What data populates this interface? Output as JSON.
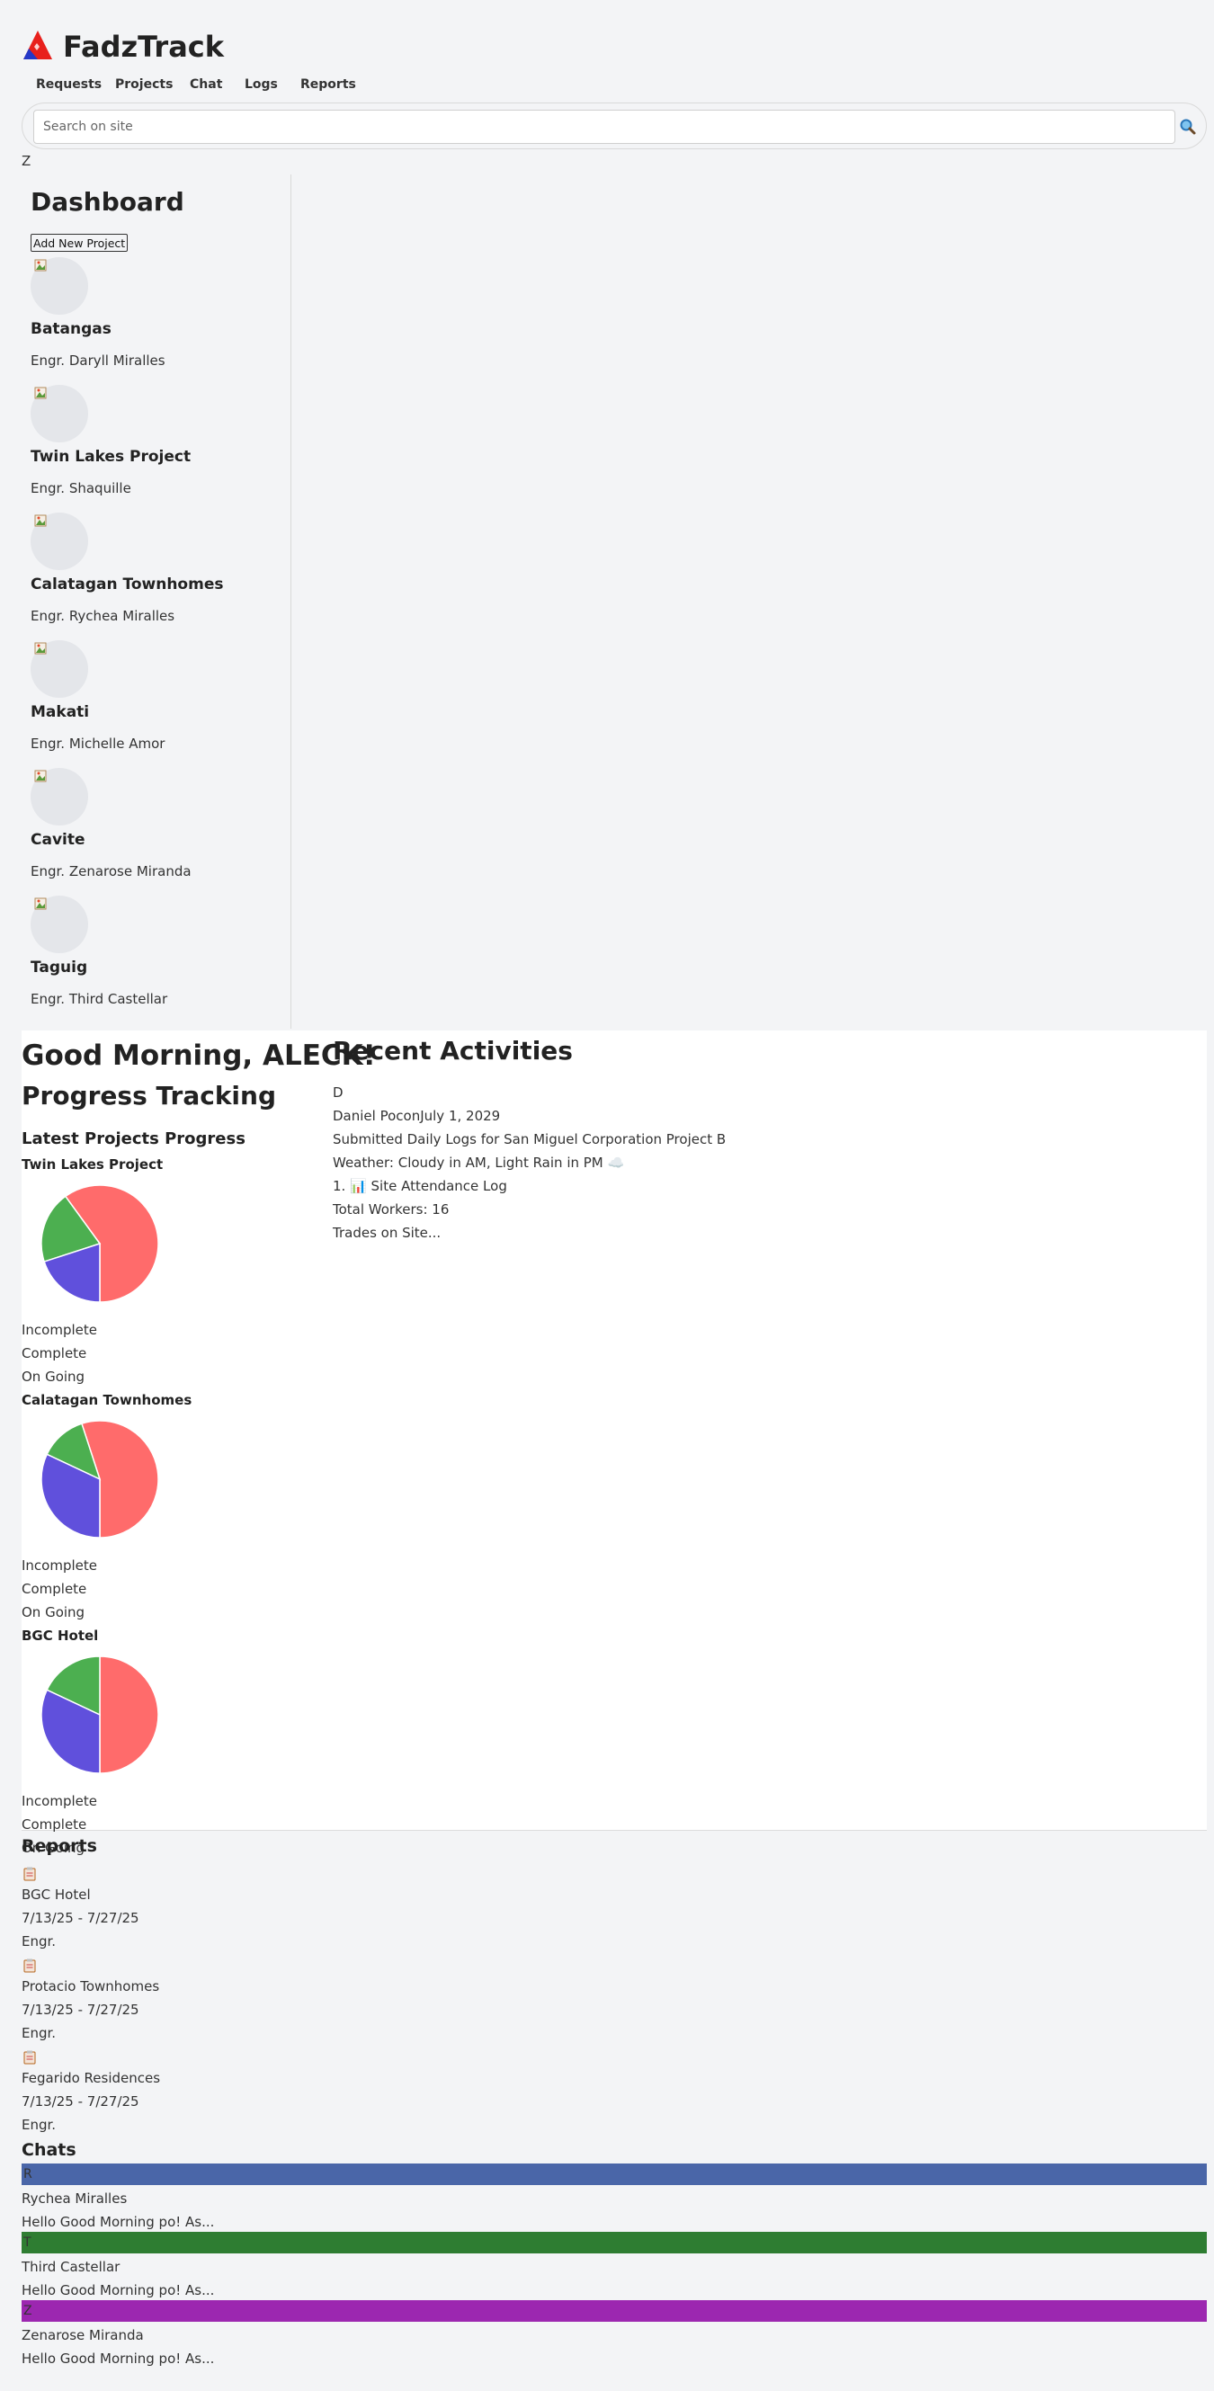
{
  "brand": "FadzTrack",
  "nav": [
    "Requests",
    "Projects",
    "Chat",
    "Logs",
    "Reports"
  ],
  "search": {
    "placeholder": "Search on site"
  },
  "user_initial": "Z",
  "sidebar": {
    "title": "Dashboard",
    "add_button": "Add New Project",
    "projects": [
      {
        "name": "Batangas",
        "engineer": "Engr. Daryll Miralles"
      },
      {
        "name": "Twin Lakes Project",
        "engineer": "Engr. Shaquille"
      },
      {
        "name": "Calatagan Townhomes",
        "engineer": "Engr. Rychea Miralles"
      },
      {
        "name": "Makati",
        "engineer": "Engr. Michelle Amor"
      },
      {
        "name": "Cavite",
        "engineer": "Engr. Zenarose Miranda"
      },
      {
        "name": "Taguig",
        "engineer": "Engr. Third Castellar"
      }
    ]
  },
  "main": {
    "greeting": "Good Morning, ALECK!",
    "progress_title": "Progress Tracking",
    "latest_title": "Latest Projects Progress",
    "legend": [
      "Incomplete",
      "Complete",
      "On Going"
    ],
    "colors": {
      "incomplete": "#ff6b6b",
      "complete": "#4caf50",
      "ongoing": "#6050dc"
    },
    "recent_title": "Recent Activities",
    "recent": {
      "initial": "D",
      "user_date": "Daniel PoconJuly 1, 2029",
      "action": "Submitted Daily Logs for San Miguel Corporation Project B",
      "weather": "Weather: Cloudy in AM, Light Rain in PM ☁️",
      "item": "1. 📊 Site Attendance Log",
      "workers": "Total Workers: 16",
      "trades": "Trades on Site..."
    }
  },
  "chart_data": [
    {
      "type": "pie",
      "title": "Twin Lakes Project",
      "categories": [
        "Incomplete",
        "Complete",
        "On Going"
      ],
      "values": [
        60,
        20,
        20
      ]
    },
    {
      "type": "pie",
      "title": "Calatagan Townhomes",
      "categories": [
        "Incomplete",
        "Complete",
        "On Going"
      ],
      "values": [
        55,
        13,
        32
      ]
    },
    {
      "type": "pie",
      "title": "BGC Hotel",
      "categories": [
        "Incomplete",
        "Complete",
        "On Going"
      ],
      "values": [
        50,
        18,
        32
      ]
    }
  ],
  "reports": {
    "title": "Reports",
    "items": [
      {
        "project": "BGC Hotel",
        "range": "7/13/25 - 7/27/25",
        "engineer": "Engr."
      },
      {
        "project": "Protacio Townhomes",
        "range": "7/13/25 - 7/27/25",
        "engineer": "Engr."
      },
      {
        "project": "Fegarido Residences",
        "range": "7/13/25 - 7/27/25",
        "engineer": "Engr."
      }
    ]
  },
  "chats": {
    "title": "Chats",
    "items": [
      {
        "initial": "R",
        "name": "Rychea Miralles",
        "message": "Hello Good Morning po! As...",
        "color": "#4a66a8"
      },
      {
        "initial": "T",
        "name": "Third Castellar",
        "message": "Hello Good Morning po! As...",
        "color": "#2e7d32"
      },
      {
        "initial": "Z",
        "name": "Zenarose Miranda",
        "message": "Hello Good Morning po! As...",
        "color": "#9c27b0"
      }
    ]
  }
}
